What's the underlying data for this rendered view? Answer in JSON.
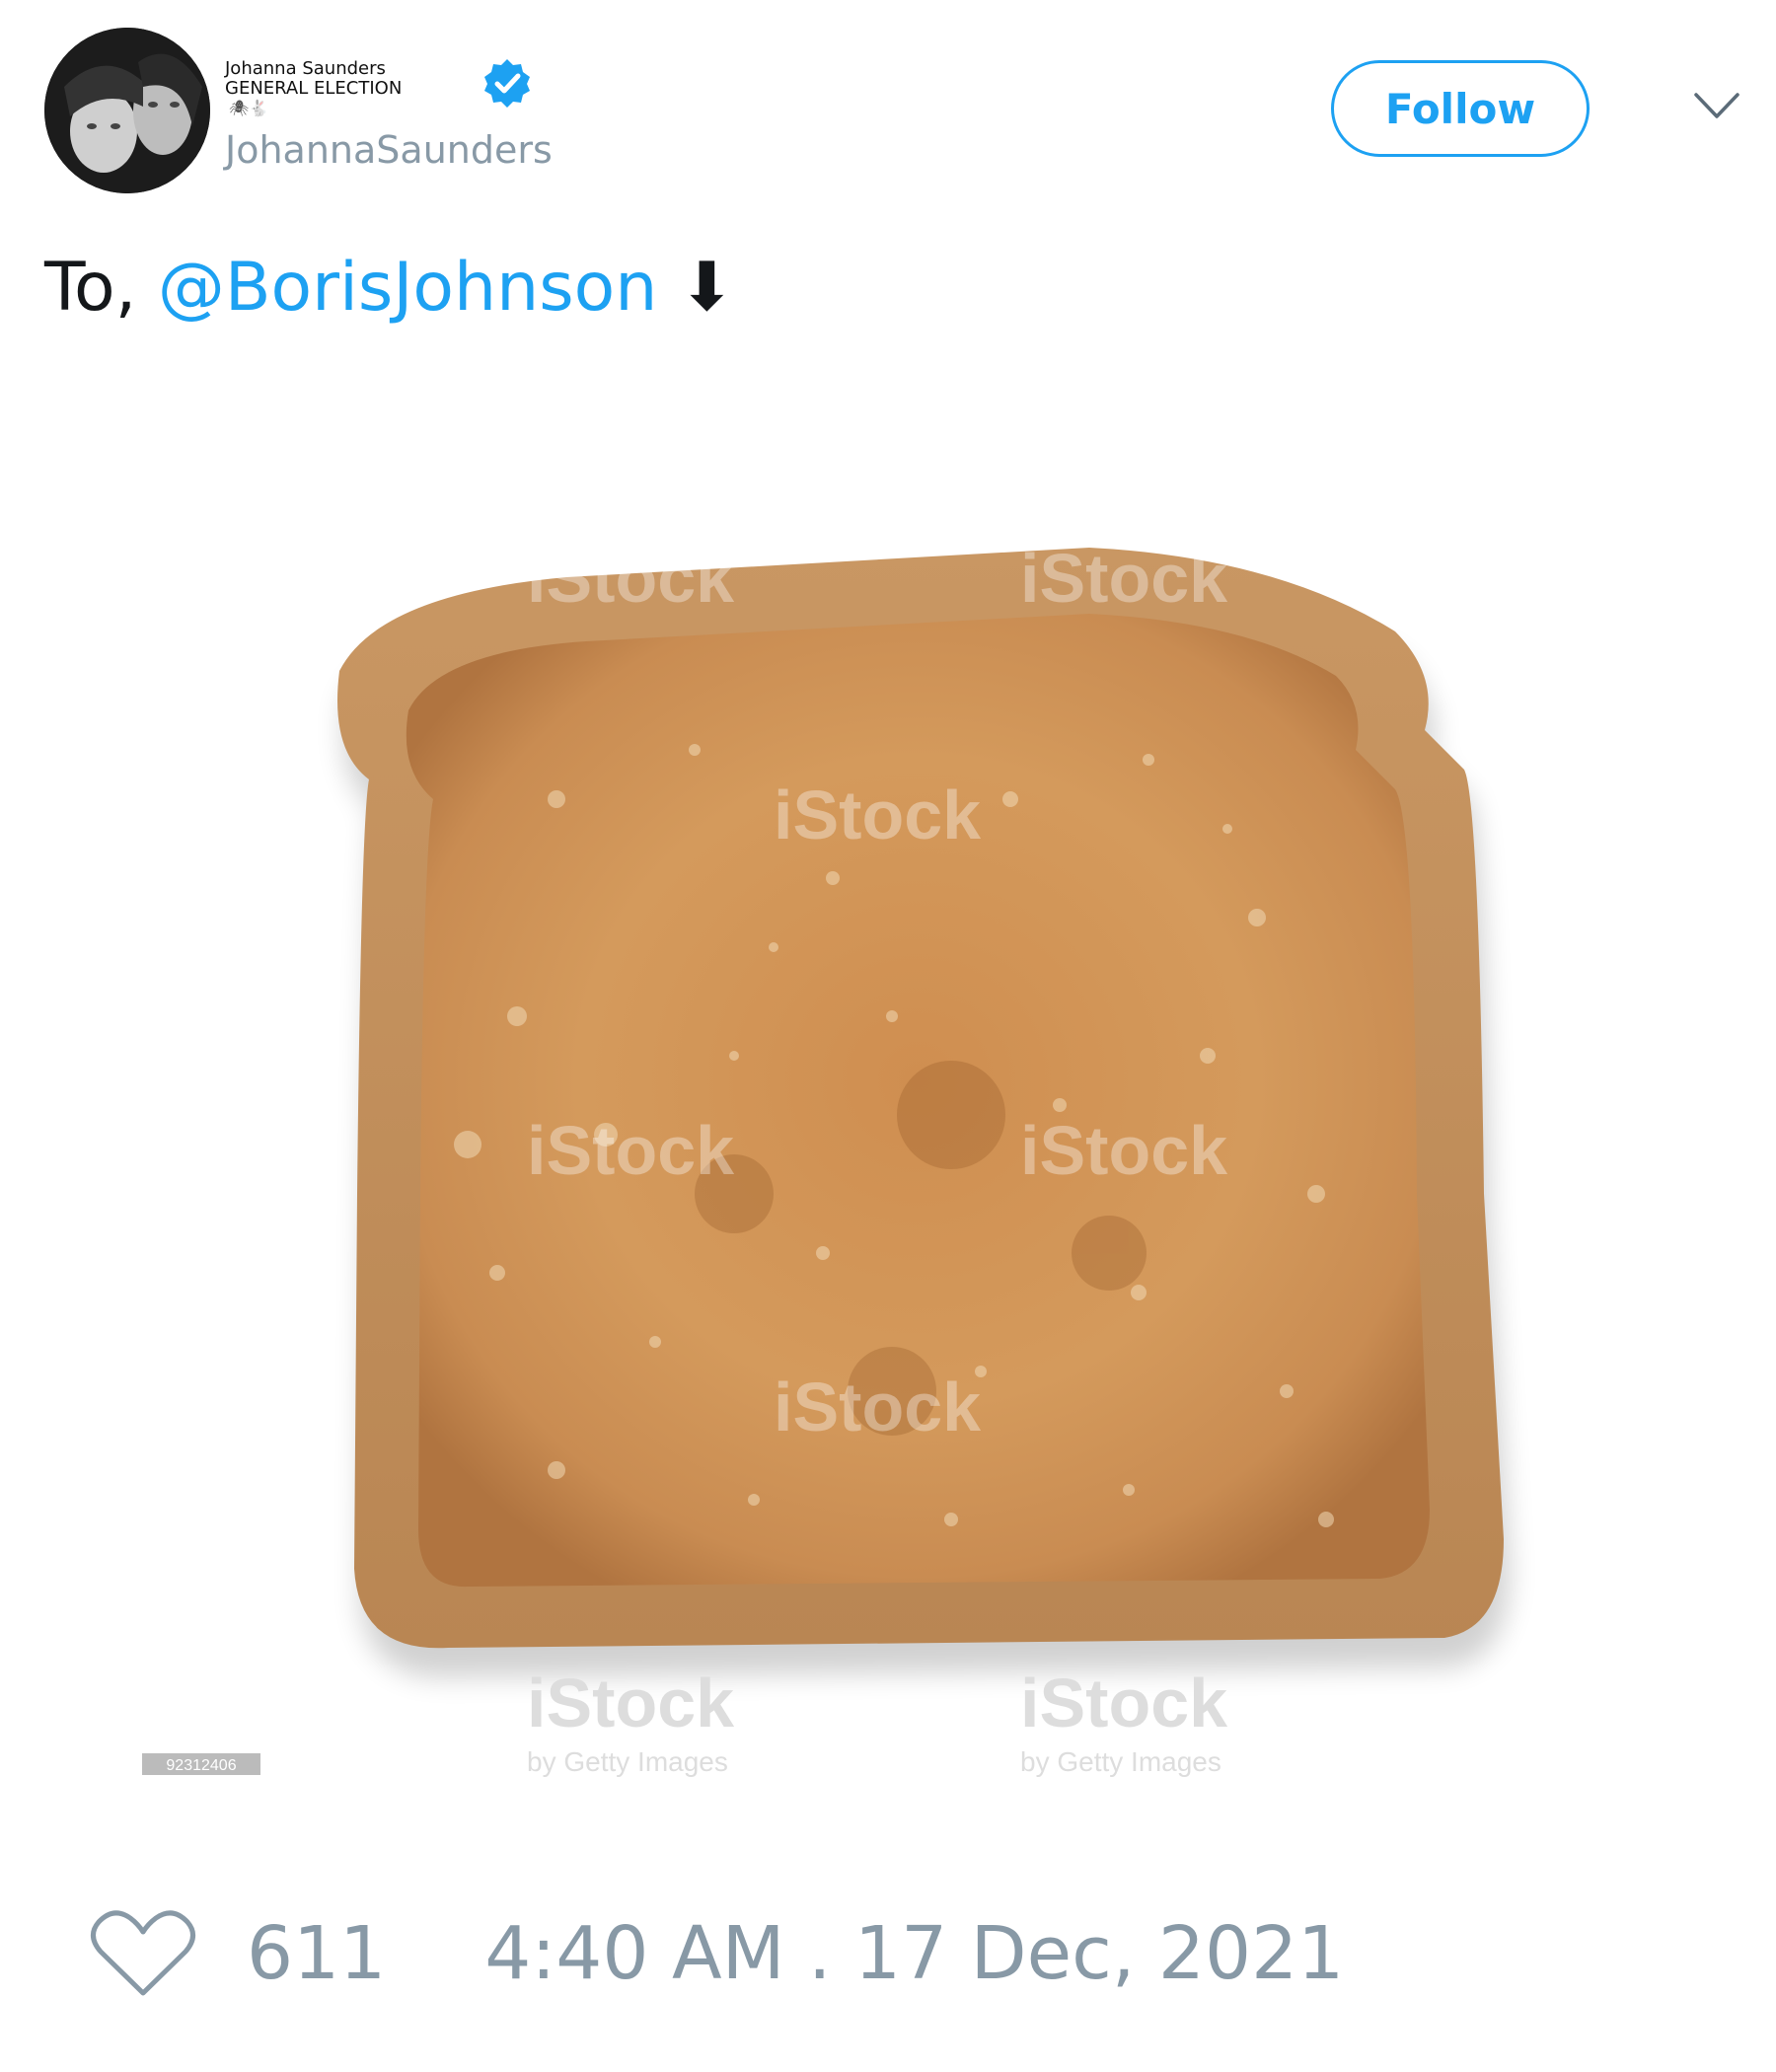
{
  "tweet": {
    "author": {
      "display_name_line1": "Johanna Saunders",
      "display_name_line2": "GENERAL ELECTION",
      "name_emoji": "🕷🐇",
      "handle": "JohannaSaunders",
      "verified": true
    },
    "follow_label": "Follow",
    "text_prefix": "To,",
    "mention": "@BorisJohnson",
    "text_suffix": "⬇",
    "image": {
      "subject": "slice of toast",
      "watermark_text": "iStock",
      "watermark_sub": "by Getty Images",
      "image_id": "92312406"
    },
    "likes": "611",
    "timestamp": "4:40 AM . 17 Dec, 2021"
  },
  "colors": {
    "accent": "#1da1f2",
    "muted": "#8899a6",
    "text": "#14171a"
  },
  "icons": [
    "verified-badge-icon",
    "chevron-down-icon",
    "heart-icon"
  ]
}
